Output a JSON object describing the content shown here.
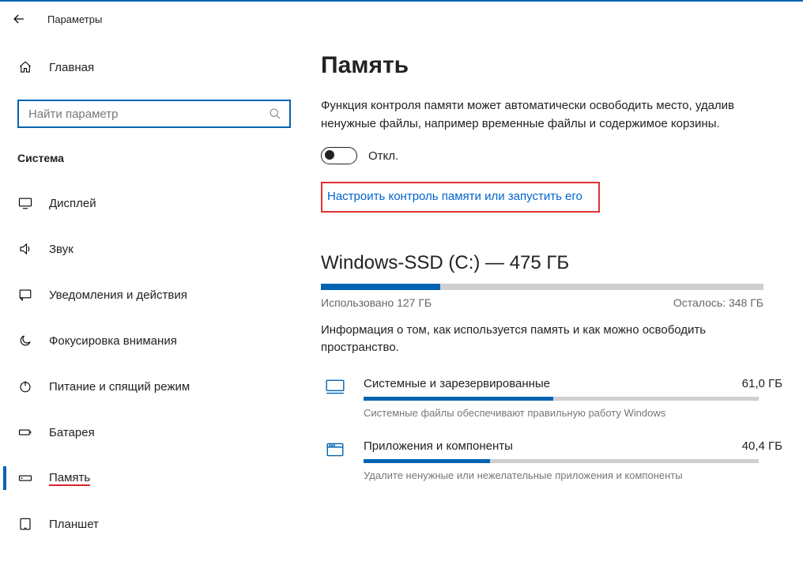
{
  "header": {
    "title": "Параметры"
  },
  "sidebar": {
    "home": "Главная",
    "search_placeholder": "Найти параметр",
    "group": "Система",
    "items": [
      {
        "label": "Дисплей"
      },
      {
        "label": "Звук"
      },
      {
        "label": "Уведомления и действия"
      },
      {
        "label": "Фокусировка внимания"
      },
      {
        "label": "Питание и спящий режим"
      },
      {
        "label": "Батарея"
      },
      {
        "label": "Память"
      },
      {
        "label": "Планшет"
      }
    ]
  },
  "main": {
    "title": "Память",
    "storage_sense_desc": "Функция контроля памяти может автоматически освободить место, удалив ненужные файлы, например временные файлы и содержимое корзины.",
    "toggle_label": "Откл.",
    "configure_link": "Настроить контроль памяти или запустить его",
    "drive": {
      "title": "Windows-SSD (C:) — 475 ГБ",
      "used_label": "Использовано 127 ГБ",
      "free_label": "Осталось: 348 ГБ",
      "used_percent": 27,
      "info": "Информация о том, как используется память и как можно освободить пространство."
    },
    "categories": [
      {
        "title": "Системные и зарезервированные",
        "size": "61,0 ГБ",
        "percent": 48,
        "desc": "Системные файлы обеспечивают правильную работу Windows"
      },
      {
        "title": "Приложения и компоненты",
        "size": "40,4 ГБ",
        "percent": 32,
        "desc": "Удалите ненужные или нежелательные приложения и компоненты"
      }
    ]
  }
}
